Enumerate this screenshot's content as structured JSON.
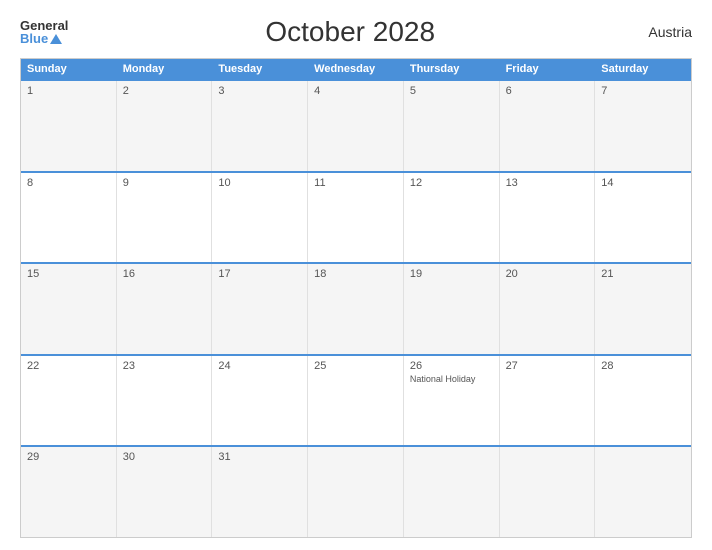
{
  "header": {
    "logo_general": "General",
    "logo_blue": "Blue",
    "title": "October 2028",
    "country": "Austria"
  },
  "calendar": {
    "days_of_week": [
      "Sunday",
      "Monday",
      "Tuesday",
      "Wednesday",
      "Thursday",
      "Friday",
      "Saturday"
    ],
    "weeks": [
      [
        {
          "day": "1",
          "event": ""
        },
        {
          "day": "2",
          "event": ""
        },
        {
          "day": "3",
          "event": ""
        },
        {
          "day": "4",
          "event": ""
        },
        {
          "day": "5",
          "event": ""
        },
        {
          "day": "6",
          "event": ""
        },
        {
          "day": "7",
          "event": ""
        }
      ],
      [
        {
          "day": "8",
          "event": ""
        },
        {
          "day": "9",
          "event": ""
        },
        {
          "day": "10",
          "event": ""
        },
        {
          "day": "11",
          "event": ""
        },
        {
          "day": "12",
          "event": ""
        },
        {
          "day": "13",
          "event": ""
        },
        {
          "day": "14",
          "event": ""
        }
      ],
      [
        {
          "day": "15",
          "event": ""
        },
        {
          "day": "16",
          "event": ""
        },
        {
          "day": "17",
          "event": ""
        },
        {
          "day": "18",
          "event": ""
        },
        {
          "day": "19",
          "event": ""
        },
        {
          "day": "20",
          "event": ""
        },
        {
          "day": "21",
          "event": ""
        }
      ],
      [
        {
          "day": "22",
          "event": ""
        },
        {
          "day": "23",
          "event": ""
        },
        {
          "day": "24",
          "event": ""
        },
        {
          "day": "25",
          "event": ""
        },
        {
          "day": "26",
          "event": "National Holiday"
        },
        {
          "day": "27",
          "event": ""
        },
        {
          "day": "28",
          "event": ""
        }
      ],
      [
        {
          "day": "29",
          "event": ""
        },
        {
          "day": "30",
          "event": ""
        },
        {
          "day": "31",
          "event": ""
        },
        {
          "day": "",
          "event": ""
        },
        {
          "day": "",
          "event": ""
        },
        {
          "day": "",
          "event": ""
        },
        {
          "day": "",
          "event": ""
        }
      ]
    ]
  }
}
